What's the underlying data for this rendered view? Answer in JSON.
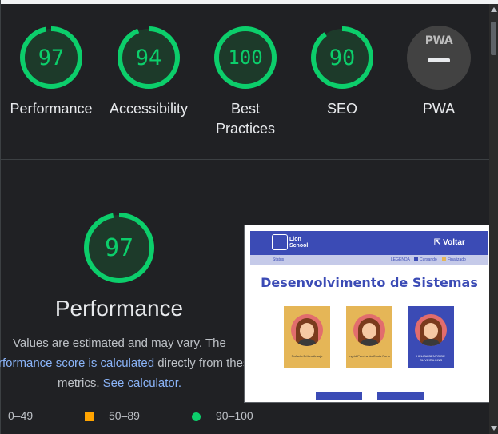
{
  "categories": [
    {
      "score": "97",
      "label": "Performance",
      "fraction": 0.97
    },
    {
      "score": "94",
      "label": "Accessibility",
      "fraction": 0.94
    },
    {
      "score": "100",
      "label_line1": "Best",
      "label_line2": "Practices",
      "fraction": 1.0
    },
    {
      "score": "90",
      "label": "SEO",
      "fraction": 0.9
    }
  ],
  "pwa": {
    "badge_text": "PWA",
    "label": "PWA"
  },
  "performance": {
    "score": "97",
    "fraction": 0.97,
    "title": "Performance",
    "desc_line1": "Values are estimated and may vary. The",
    "desc_link1": "rformance score is calculated",
    "desc_line2_tail": "directly from these",
    "desc_line3_pre": "metrics.",
    "desc_link2": "See calculator."
  },
  "legend": {
    "fail": "0–49",
    "average": "50–89",
    "pass": "90–100"
  },
  "thumbnail": {
    "logo_line1": "Lion",
    "logo_line2": "School",
    "back_label": "Voltar",
    "status_label": "Status",
    "legend_label": "LEGENDA",
    "legend_item1": "Cursando",
    "legend_item2": "Finalizado",
    "title": "Desenvolvimento de Sistemas",
    "cards": [
      {
        "name": "Rafaela Brittes Araujo"
      },
      {
        "name": "Ingrid Pereira da Costa Porto"
      },
      {
        "name": "HÉLISA BENTO DE OLIVEIRA LINS"
      }
    ]
  },
  "colors": {
    "pass": "#0cce6b",
    "average": "#ffa400",
    "background": "#202124",
    "thumb_blue": "#3b4bb5",
    "thumb_gold": "#e5b657"
  }
}
